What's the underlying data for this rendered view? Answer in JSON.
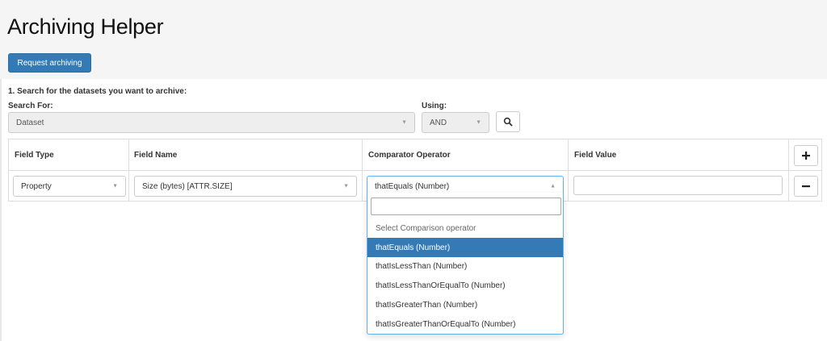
{
  "header": {
    "title": "Archiving Helper",
    "request_button": "Request archiving"
  },
  "search": {
    "step_label": "1. Search for the datasets you want to archive:",
    "search_for_label": "Search For:",
    "search_for_value": "Dataset",
    "using_label": "Using:",
    "using_value": "AND"
  },
  "table": {
    "headers": [
      "Field Type",
      "Field Name",
      "Comparator Operator",
      "Field Value"
    ],
    "row": {
      "field_type": "Property",
      "field_name": "Size (bytes) [ATTR.SIZE]",
      "comparator": "thatEquals (Number)",
      "field_value": ""
    }
  },
  "dropdown": {
    "search_value": "",
    "placeholder": "Select Comparison operator",
    "options": [
      "thatEquals (Number)",
      "thatIsLessThan (Number)",
      "thatIsLessThanOrEqualTo (Number)",
      "thatIsGreaterThan (Number)",
      "thatIsGreaterThanOrEqualTo (Number)"
    ],
    "selected_option": "thatEquals (Number)"
  },
  "icons": {
    "search": "search-icon",
    "add": "plus-icon",
    "remove": "minus-icon",
    "caret_down": "caret-down-icon",
    "caret_up": "caret-up-icon"
  },
  "colors": {
    "primary": "#337ab7",
    "header_bg": "#f5f5f5",
    "focus_border": "#66afe9"
  }
}
